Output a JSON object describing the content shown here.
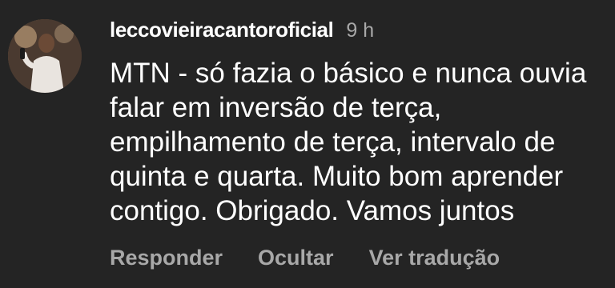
{
  "comment": {
    "username": "leccovieiracantoroficial",
    "timestamp": "9 h",
    "text": "MTN - só fazia o básico e nunca ouvia falar em inversão de terça, empilhamento de terça, intervalo de quinta e quarta. Muito bom aprender contigo. Obrigado. Vamos juntos",
    "actions": {
      "reply": "Responder",
      "hide": "Ocultar",
      "translate": "Ver tradução"
    }
  },
  "icons": {
    "avatar": "profile-photo-avatar"
  },
  "colors": {
    "background": "#242424",
    "primary_text": "#ffffff",
    "secondary_text": "#a8a8a8"
  }
}
